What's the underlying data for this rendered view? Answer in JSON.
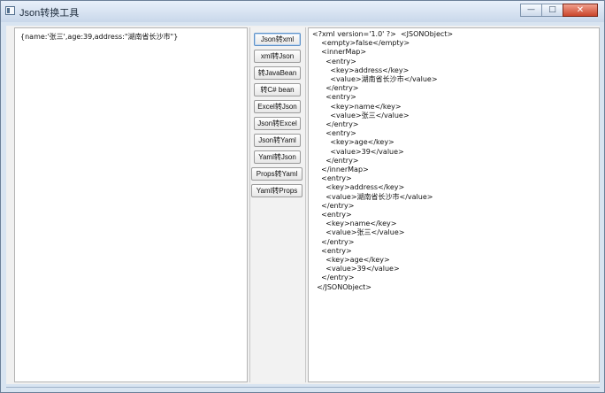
{
  "window": {
    "title": "Json转换工具"
  },
  "input_text": "{name:'张三',age:39,address:\"湖南省长沙市\"}",
  "buttons": [
    {
      "label": "Json转xml"
    },
    {
      "label": "xml转Json"
    },
    {
      "label": "转JavaBean"
    },
    {
      "label": "转C# bean"
    },
    {
      "label": "Excel转Json"
    },
    {
      "label": "Json转Excel"
    },
    {
      "label": "Json转Yaml"
    },
    {
      "label": "Yaml转Json"
    },
    {
      "label": "Props转Yaml"
    },
    {
      "label": "Yaml转Props"
    }
  ],
  "output_lines": [
    "<?xml version='1.0' ?>  <JSONObject>",
    "    <empty>false</empty>",
    "    <innerMap>",
    "      <entry>",
    "        <key>address</key>",
    "        <value>湖南省长沙市</value>",
    "      </entry>",
    "      <entry>",
    "        <key>name</key>",
    "        <value>张三</value>",
    "      </entry>",
    "      <entry>",
    "        <key>age</key>",
    "        <value>39</value>",
    "      </entry>",
    "    </innerMap>",
    "    <entry>",
    "      <key>address</key>",
    "      <value>湖南省长沙市</value>",
    "    </entry>",
    "    <entry>",
    "      <key>name</key>",
    "      <value>张三</value>",
    "    </entry>",
    "    <entry>",
    "      <key>age</key>",
    "      <value>39</value>",
    "    </entry>",
    "  </JSONObject>"
  ]
}
